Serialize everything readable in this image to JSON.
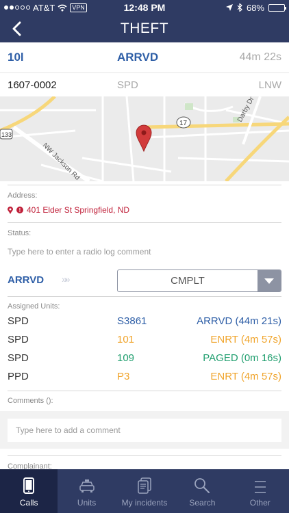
{
  "status_bar": {
    "carrier": "AT&T",
    "vpn": "VPN",
    "time": "12:48 PM",
    "battery": "68%",
    "battery_level": 0.68
  },
  "nav": {
    "title": "THEFT",
    "back_icon": "chevron-left-icon"
  },
  "incident": {
    "unit": "10l",
    "status": "ARRVD",
    "elapsed": "44m 22s",
    "number": "1607-0002",
    "agency": "SPD",
    "area": "LNW"
  },
  "map": {
    "labels": [
      "133",
      "NW Jackson Rd",
      "17",
      "Darby Dr"
    ],
    "pin_icon": "map-pin-icon"
  },
  "address": {
    "label": "Address:",
    "value": "401 Elder St Springfield, ND",
    "alert_mark": "!"
  },
  "status": {
    "label": "Status:",
    "placeholder": "Type here to enter a radio log comment",
    "current": "ARRVD",
    "chevrons": "»»",
    "next_option": "CMPLT"
  },
  "assigned_units": {
    "label": "Assigned Units:",
    "rows": [
      {
        "agency": "SPD",
        "unit": "S3861",
        "status": "ARRVD (44m 21s)",
        "color": "#2f5fa7"
      },
      {
        "agency": "SPD",
        "unit": "101",
        "status": "ENRT (4m 57s)",
        "color": "#f0a42b"
      },
      {
        "agency": "SPD",
        "unit": "109",
        "status": "PAGED (0m 16s)",
        "color": "#1f9e6e"
      },
      {
        "agency": "PPD",
        "unit": "P3",
        "status": "ENRT (4m 57s)",
        "color": "#f0a42b"
      }
    ]
  },
  "comments": {
    "label": "Comments ():",
    "placeholder": "Type here to add a comment"
  },
  "complainant": {
    "label": "Complainant:"
  },
  "tabs": [
    {
      "label": "Calls",
      "icon": "phone-icon",
      "active": true
    },
    {
      "label": "Units",
      "icon": "car-icon",
      "active": false
    },
    {
      "label": "My incidents",
      "icon": "documents-icon",
      "active": false
    },
    {
      "label": "Search",
      "icon": "search-icon",
      "active": false
    },
    {
      "label": "Other",
      "icon": "menu-icon",
      "active": false
    }
  ],
  "colors": {
    "nav_bg": "#2f3b63",
    "accent_blue": "#2f5fa7",
    "alert_red": "#c0213a",
    "enroute_orange": "#f0a42b",
    "paged_green": "#1f9e6e"
  }
}
